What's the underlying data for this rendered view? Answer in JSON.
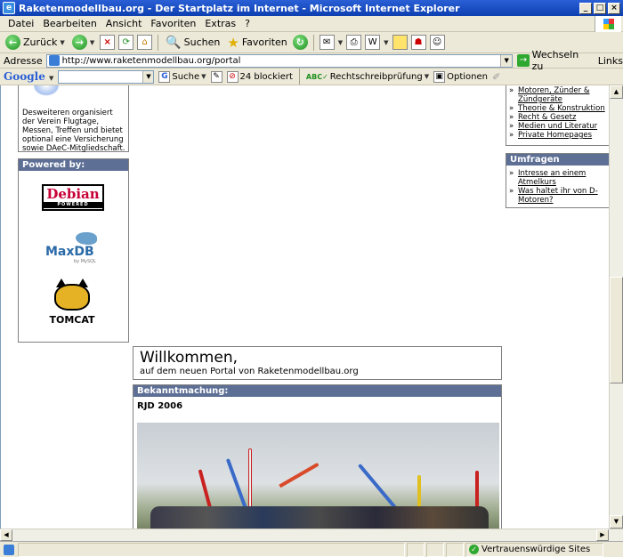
{
  "window": {
    "title": "Raketenmodellbau.org - Der Startplatz im Internet - Microsoft Internet Explorer"
  },
  "menu": [
    "Datei",
    "Bearbeiten",
    "Ansicht",
    "Favoriten",
    "Extras",
    "?"
  ],
  "toolbar": {
    "back": "Zurück",
    "search": "Suchen",
    "favorites": "Favoriten"
  },
  "address": {
    "label": "Adresse",
    "url": "http://www.raketenmodellbau.org/portal",
    "go": "Wechseln zu",
    "links": "Links"
  },
  "googlebar": {
    "logo": "Google",
    "search": "Suche",
    "blocked": "24 blockiert",
    "spell": "Rechtschreibprüfung",
    "options": "Optionen"
  },
  "left": {
    "intro_text": "Desweiteren organisiert der Verein Flugtage, Messen, Treffen und bietet optional eine Versicherung sowie DAeC-Mitgliedschaft.",
    "powered_header": "Powered by:",
    "debian": "Debian",
    "debian_sub": "POWERED",
    "maxdb": "MaxDB",
    "maxdb_by": "by MySQL",
    "tomcat": "TOMCAT"
  },
  "right": {
    "links": [
      "Motoren, Zünder & Zündgeräte",
      "Theorie & Konstruktion",
      "Recht & Gesetz",
      "Medien und Literatur",
      "Private Homepages"
    ],
    "poll_header": "Umfragen",
    "polls": [
      "Intresse an einem Atmelkurs",
      "Was haltet ihr von D-Motoren?"
    ]
  },
  "main": {
    "welcome_title": "Willkommen,",
    "welcome_sub": "auf dem neuen Portal von Raketenmodellbau.org",
    "announce_header": "Bekanntmachung:",
    "announce_title": "RJD 2006"
  },
  "status": {
    "zone": "Vertrauenswürdige Sites"
  }
}
